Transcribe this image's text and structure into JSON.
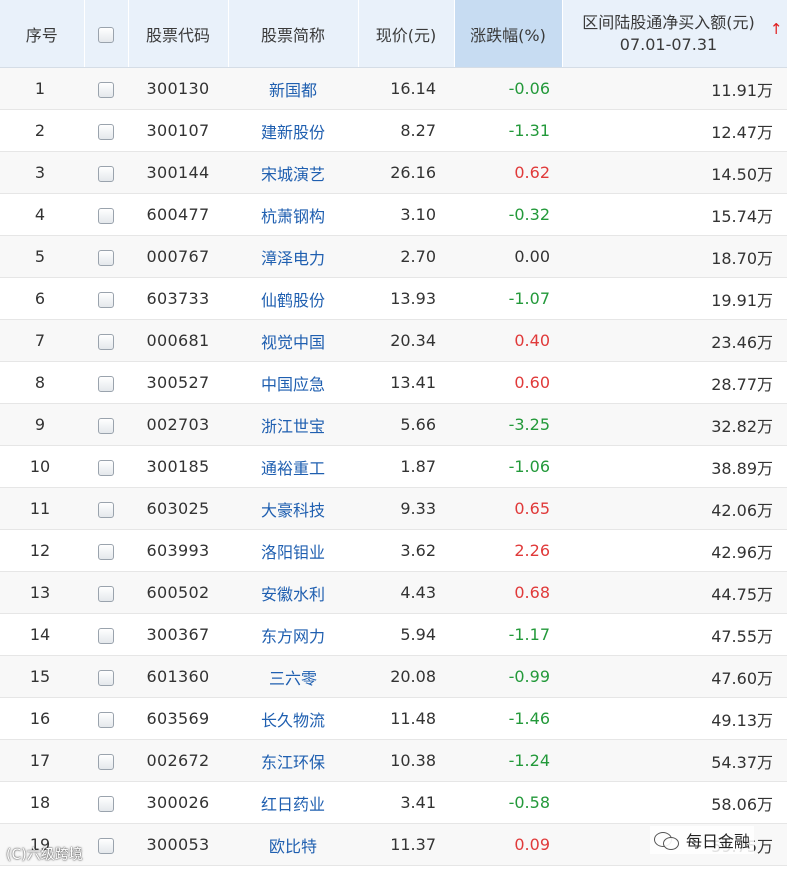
{
  "header": {
    "index": "序号",
    "code": "股票代码",
    "name": "股票简称",
    "price": "现价(元)",
    "change": "涨跌幅(%)",
    "amount_title": "区间陆股通净买入额(元)",
    "amount_range": "07.01-07.31",
    "sort_arrow": "↑"
  },
  "colors": {
    "up": "#e03a3a",
    "down": "#23993a",
    "link": "#1f5fb0",
    "sorted_header": "#c7dcf2",
    "header_bg": "#e9f1fa"
  },
  "rows": [
    {
      "idx": "1",
      "code": "300130",
      "name": "新国都",
      "price": "16.14",
      "change": "-0.06",
      "dir": "down",
      "amount": "11.91万"
    },
    {
      "idx": "2",
      "code": "300107",
      "name": "建新股份",
      "price": "8.27",
      "change": "-1.31",
      "dir": "down",
      "amount": "12.47万"
    },
    {
      "idx": "3",
      "code": "300144",
      "name": "宋城演艺",
      "price": "26.16",
      "change": "0.62",
      "dir": "up",
      "amount": "14.50万"
    },
    {
      "idx": "4",
      "code": "600477",
      "name": "杭萧钢构",
      "price": "3.10",
      "change": "-0.32",
      "dir": "down",
      "amount": "15.74万"
    },
    {
      "idx": "5",
      "code": "000767",
      "name": "漳泽电力",
      "price": "2.70",
      "change": "0.00",
      "dir": "flat",
      "amount": "18.70万"
    },
    {
      "idx": "6",
      "code": "603733",
      "name": "仙鹤股份",
      "price": "13.93",
      "change": "-1.07",
      "dir": "down",
      "amount": "19.91万"
    },
    {
      "idx": "7",
      "code": "000681",
      "name": "视觉中国",
      "price": "20.34",
      "change": "0.40",
      "dir": "up",
      "amount": "23.46万"
    },
    {
      "idx": "8",
      "code": "300527",
      "name": "中国应急",
      "price": "13.41",
      "change": "0.60",
      "dir": "up",
      "amount": "28.77万"
    },
    {
      "idx": "9",
      "code": "002703",
      "name": "浙江世宝",
      "price": "5.66",
      "change": "-3.25",
      "dir": "down",
      "amount": "32.82万"
    },
    {
      "idx": "10",
      "code": "300185",
      "name": "通裕重工",
      "price": "1.87",
      "change": "-1.06",
      "dir": "down",
      "amount": "38.89万"
    },
    {
      "idx": "11",
      "code": "603025",
      "name": "大豪科技",
      "price": "9.33",
      "change": "0.65",
      "dir": "up",
      "amount": "42.06万"
    },
    {
      "idx": "12",
      "code": "603993",
      "name": "洛阳钼业",
      "price": "3.62",
      "change": "2.26",
      "dir": "up",
      "amount": "42.96万"
    },
    {
      "idx": "13",
      "code": "600502",
      "name": "安徽水利",
      "price": "4.43",
      "change": "0.68",
      "dir": "up",
      "amount": "44.75万"
    },
    {
      "idx": "14",
      "code": "300367",
      "name": "东方网力",
      "price": "5.94",
      "change": "-1.17",
      "dir": "down",
      "amount": "47.55万"
    },
    {
      "idx": "15",
      "code": "601360",
      "name": "三六零",
      "price": "20.08",
      "change": "-0.99",
      "dir": "down",
      "amount": "47.60万"
    },
    {
      "idx": "16",
      "code": "603569",
      "name": "长久物流",
      "price": "11.48",
      "change": "-1.46",
      "dir": "down",
      "amount": "49.13万"
    },
    {
      "idx": "17",
      "code": "002672",
      "name": "东江环保",
      "price": "10.38",
      "change": "-1.24",
      "dir": "down",
      "amount": "54.37万"
    },
    {
      "idx": "18",
      "code": "300026",
      "name": "红日药业",
      "price": "3.41",
      "change": "-0.58",
      "dir": "down",
      "amount": "58.06万"
    },
    {
      "idx": "19",
      "code": "300053",
      "name": "欧比特",
      "price": "11.37",
      "change": "0.09",
      "dir": "up",
      "amount": "59.75万"
    }
  ],
  "watermarks": {
    "left": "(C)六级跨境",
    "right": "每日金融"
  }
}
